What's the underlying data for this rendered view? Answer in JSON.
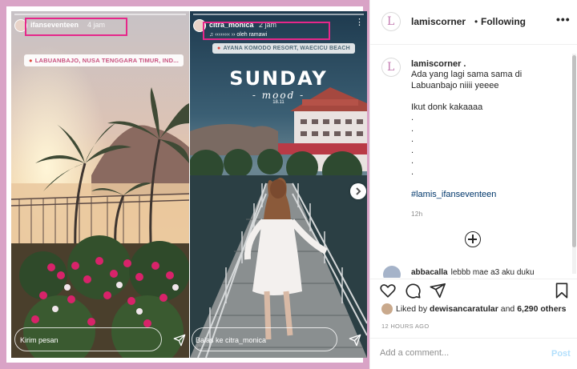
{
  "stories": {
    "left": {
      "username": "ifanseventeen",
      "time": "4 jam",
      "location": "LABUANBAJO, NUSA TENGGARA TIMUR, IND...",
      "reply_placeholder": "Kirim pesan"
    },
    "right": {
      "username": "citra_monica",
      "time": "2 jam",
      "subtitle": "♫ ‹‹‹‹‹‹‹‹ ›› oleh ramawi",
      "location": "AYANA KOMODO RESORT, WAECICU BEACH",
      "title_big": "SUNDAY",
      "title_script": "- mood -",
      "title_date": "18.11",
      "reply_placeholder": "Balas ke citra_monica"
    }
  },
  "header": {
    "username": "lamiscorner",
    "separator": "•",
    "follow_status": "Following",
    "more_label": "•••"
  },
  "caption": {
    "username": "lamiscorner .",
    "lines": [
      "Ada yang lagi sama sama di",
      "Labuanbajo niiii yeeee",
      "",
      "Ikut donk kakaaaa",
      ".",
      ".",
      ".",
      ".",
      ".",
      "."
    ],
    "hashtag": "#lamis_ifanseventeen",
    "time": "12h"
  },
  "comment_peek": {
    "username": "abbacalla",
    "text": "lebbb mae a3 aku duku"
  },
  "likes": {
    "prefix": "Liked by ",
    "user": "dewisancaratular",
    "middle": " and ",
    "others": "6,290 others"
  },
  "post_time": "12 HOURS AGO",
  "comment_box": {
    "placeholder": "Add a comment...",
    "post_label": "Post"
  }
}
